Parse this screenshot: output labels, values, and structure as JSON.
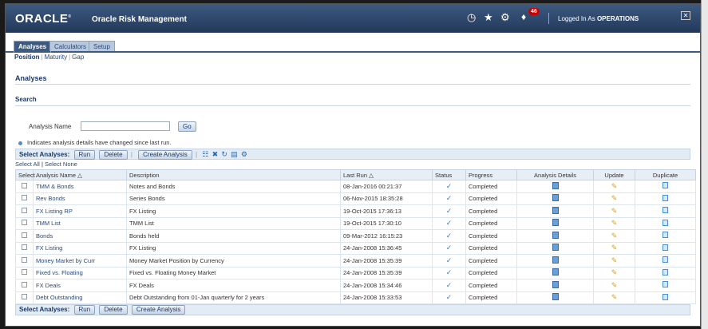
{
  "header": {
    "logo": "ORACLE",
    "app_name": "Oracle Risk Management",
    "notification_count": "46",
    "logged_in_prefix": "Logged In As ",
    "logged_in_user": "OPERATIONS"
  },
  "tabs": [
    {
      "label": "Analyses",
      "active": true
    },
    {
      "label": "Calculators",
      "active": false
    },
    {
      "label": "Setup",
      "active": false
    }
  ],
  "subnav": [
    "Position",
    "Maturity",
    "Gap"
  ],
  "page_title": "Analyses",
  "search": {
    "title": "Search",
    "label": "Analysis Name",
    "value": "",
    "go_label": "Go"
  },
  "note": "Indicates analysis details have changed since last run.",
  "toolbar": {
    "select_label": "Select Analyses:",
    "run_label": "Run",
    "delete_label": "Delete",
    "create_label": "Create Analysis"
  },
  "select_all": "Select All",
  "select_none": "Select None",
  "columns": [
    "Select",
    "Analysis Name",
    "Description",
    "Last Run",
    "Status",
    "Progress",
    "Analysis Details",
    "Update",
    "Duplicate"
  ],
  "rows": [
    {
      "name": "TMM & Bonds",
      "description": "Notes and Bonds",
      "last_run": "08-Jan-2016 00:21:37",
      "progress": "Completed"
    },
    {
      "name": "Rev Bonds",
      "description": "Series Bonds",
      "last_run": "06-Nov-2015 18:35:28",
      "progress": "Completed"
    },
    {
      "name": "FX Listing RP",
      "description": "FX Listing",
      "last_run": "19-Oct-2015 17:36:13",
      "progress": "Completed"
    },
    {
      "name": "TMM List",
      "description": "TMM List",
      "last_run": "19-Oct-2015 17:30:10",
      "progress": "Completed"
    },
    {
      "name": "Bonds",
      "description": "Bonds held",
      "last_run": "09-Mar-2012 16:15:23",
      "progress": "Completed"
    },
    {
      "name": "FX Listing",
      "description": "FX Listing",
      "last_run": "24-Jan-2008 15:36:45",
      "progress": "Completed"
    },
    {
      "name": "Money Market by Curr",
      "description": "Money Market Position by Currency",
      "last_run": "24-Jan-2008 15:35:39",
      "progress": "Completed"
    },
    {
      "name": "Fixed vs. Floating",
      "description": "Fixed vs. Floating Money Market",
      "last_run": "24-Jan-2008 15:35:39",
      "progress": "Completed"
    },
    {
      "name": "FX Deals",
      "description": "FX Deals",
      "last_run": "24-Jan-2008 15:34:46",
      "progress": "Completed"
    },
    {
      "name": "Debt Outstanding",
      "description": "Debt Outstanding from 01-Jan quarterly for 2 years",
      "last_run": "24-Jan-2008 15:33:53",
      "progress": "Completed"
    }
  ],
  "bottom_toolbar": {
    "select_label": "Select Analyses:",
    "run_label": "Run",
    "delete_label": "Delete",
    "create_label": "Create Analysis"
  },
  "colors": {
    "header": "#2e4a70",
    "accent": "#3d5a80",
    "link": "#2a4a7a"
  }
}
